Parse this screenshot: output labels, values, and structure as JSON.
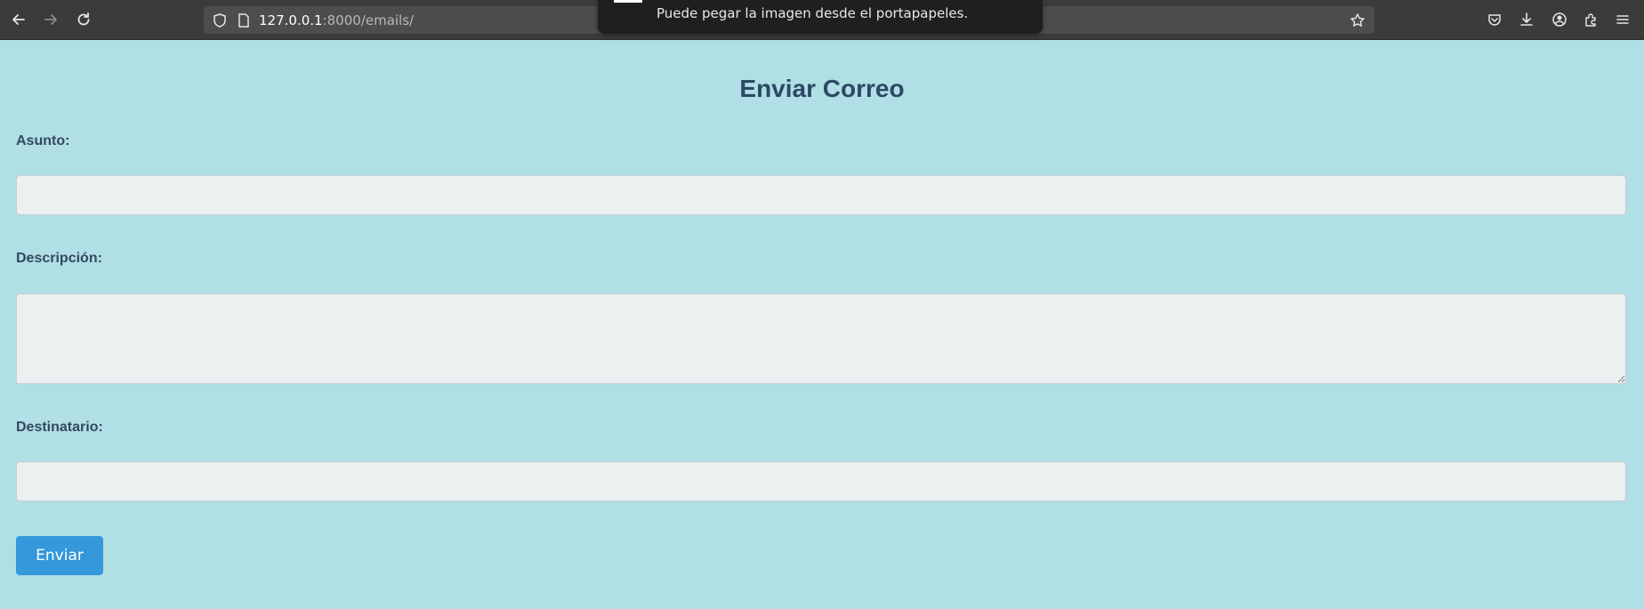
{
  "browser": {
    "url_host": "127.0.0.1",
    "url_path": ":8000/emails/",
    "notification_text": "Puede pegar la imagen desde el portapapeles."
  },
  "icons": {
    "back": "back-arrow-icon",
    "forward": "forward-arrow-icon",
    "reload": "reload-icon",
    "shield": "shield-icon",
    "page": "page-icon",
    "bookmark": "star-icon",
    "pocket": "pocket-icon",
    "downloads": "download-icon",
    "account": "account-icon",
    "extensions": "extensions-icon",
    "menu": "hamburger-menu-icon"
  },
  "form": {
    "title": "Enviar Correo",
    "subject_label": "Asunto:",
    "subject_value": "",
    "description_label": "Descripción:",
    "description_value": "",
    "recipient_label": "Destinatario:",
    "recipient_value": "",
    "submit_label": "Enviar"
  },
  "colors": {
    "page_background": "#b0dfe5",
    "title_text": "#2c4a63",
    "input_background": "#ecf0f1",
    "button_background": "#3498db",
    "toolbar_background": "#3b3b3b"
  }
}
